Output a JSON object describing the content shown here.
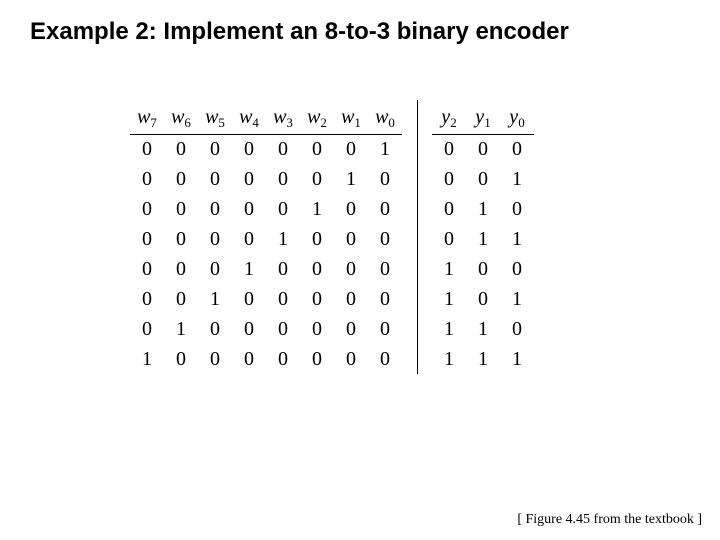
{
  "title": "Example 2: Implement an 8-to-3 binary encoder",
  "caption": "[ Figure 4.45 from the textbook ]",
  "chart_data": {
    "type": "table",
    "input_headers": [
      "w7",
      "w6",
      "w5",
      "w4",
      "w3",
      "w2",
      "w1",
      "w0"
    ],
    "output_headers": [
      "y2",
      "y1",
      "y0"
    ],
    "rows": [
      {
        "w": [
          0,
          0,
          0,
          0,
          0,
          0,
          0,
          1
        ],
        "y": [
          0,
          0,
          0
        ]
      },
      {
        "w": [
          0,
          0,
          0,
          0,
          0,
          0,
          1,
          0
        ],
        "y": [
          0,
          0,
          1
        ]
      },
      {
        "w": [
          0,
          0,
          0,
          0,
          0,
          1,
          0,
          0
        ],
        "y": [
          0,
          1,
          0
        ]
      },
      {
        "w": [
          0,
          0,
          0,
          0,
          1,
          0,
          0,
          0
        ],
        "y": [
          0,
          1,
          1
        ]
      },
      {
        "w": [
          0,
          0,
          0,
          1,
          0,
          0,
          0,
          0
        ],
        "y": [
          1,
          0,
          0
        ]
      },
      {
        "w": [
          0,
          0,
          1,
          0,
          0,
          0,
          0,
          0
        ],
        "y": [
          1,
          0,
          1
        ]
      },
      {
        "w": [
          0,
          1,
          0,
          0,
          0,
          0,
          0,
          0
        ],
        "y": [
          1,
          1,
          0
        ]
      },
      {
        "w": [
          1,
          0,
          0,
          0,
          0,
          0,
          0,
          0
        ],
        "y": [
          1,
          1,
          1
        ]
      }
    ],
    "header_var_inputs": "w",
    "header_var_outputs": "y"
  }
}
